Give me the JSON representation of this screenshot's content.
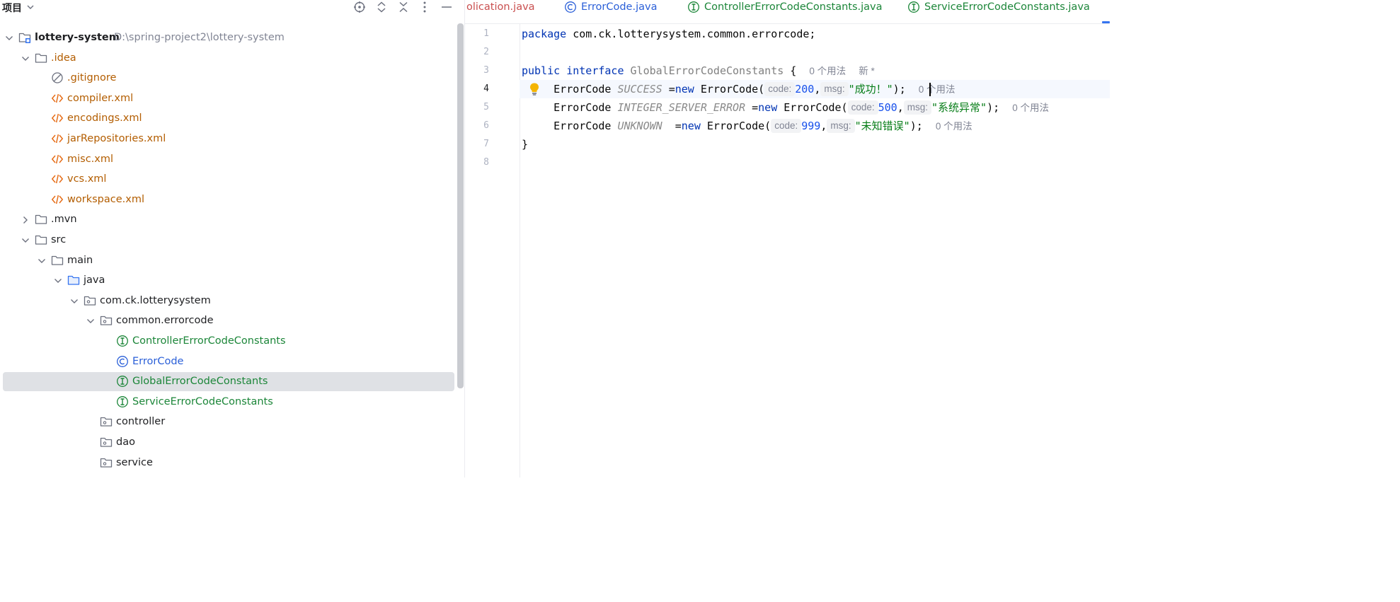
{
  "project_panel": {
    "title": "项目",
    "header_icons": [
      "locate-icon",
      "expand-all-icon",
      "collapse-all-icon",
      "more-options-icon",
      "minimize-icon"
    ],
    "tree": [
      {
        "label": "lottery-system",
        "path": "D:\\spring-project2\\lottery-system",
        "icon": "module-folder-icon",
        "depth": 0,
        "expanded": true,
        "color": "folder",
        "bold": true
      },
      {
        "label": ".idea",
        "icon": "folder-icon",
        "depth": 1,
        "expanded": true,
        "color": "idea"
      },
      {
        "label": ".gitignore",
        "icon": "ignored-file-icon",
        "depth": 2,
        "color": "idea"
      },
      {
        "label": "compiler.xml",
        "icon": "xml-file-icon",
        "depth": 2,
        "color": "xml"
      },
      {
        "label": "encodings.xml",
        "icon": "xml-file-icon",
        "depth": 2,
        "color": "xml"
      },
      {
        "label": "jarRepositories.xml",
        "icon": "xml-file-icon",
        "depth": 2,
        "color": "xml"
      },
      {
        "label": "misc.xml",
        "icon": "xml-file-icon",
        "depth": 2,
        "color": "xml"
      },
      {
        "label": "vcs.xml",
        "icon": "xml-file-icon",
        "depth": 2,
        "color": "xml"
      },
      {
        "label": "workspace.xml",
        "icon": "xml-file-icon",
        "depth": 2,
        "color": "xml"
      },
      {
        "label": ".mvn",
        "icon": "folder-icon",
        "depth": 1,
        "expanded": false,
        "color": "folder"
      },
      {
        "label": "src",
        "icon": "folder-icon",
        "depth": 1,
        "expanded": true,
        "color": "folder"
      },
      {
        "label": "main",
        "icon": "folder-icon",
        "depth": 2,
        "expanded": true,
        "color": "folder"
      },
      {
        "label": "java",
        "icon": "source-folder-icon",
        "depth": 3,
        "expanded": true,
        "color": "folder"
      },
      {
        "label": "com.ck.lotterysystem",
        "icon": "package-icon",
        "depth": 4,
        "expanded": true,
        "color": "folder"
      },
      {
        "label": "common.errorcode",
        "icon": "package-icon",
        "depth": 5,
        "expanded": true,
        "color": "folder"
      },
      {
        "label": "ControllerErrorCodeConstants",
        "icon": "interface-icon",
        "depth": 6,
        "color": "iface"
      },
      {
        "label": "ErrorCode",
        "icon": "class-icon",
        "depth": 6,
        "color": "class"
      },
      {
        "label": "GlobalErrorCodeConstants",
        "icon": "interface-icon",
        "depth": 6,
        "color": "iface",
        "selected": true
      },
      {
        "label": "ServiceErrorCodeConstants",
        "icon": "interface-icon",
        "depth": 6,
        "color": "iface"
      },
      {
        "label": "controller",
        "icon": "package-icon",
        "depth": 5,
        "color": "folder"
      },
      {
        "label": "dao",
        "icon": "package-icon",
        "depth": 5,
        "color": "folder"
      },
      {
        "label": "service",
        "icon": "package-icon",
        "depth": 5,
        "color": "folder"
      }
    ]
  },
  "tabs": [
    {
      "label": "olication.java",
      "icon": null,
      "color": "#c94f4f"
    },
    {
      "label": "ErrorCode.java",
      "icon": "class-icon",
      "color": "#2a5fd8"
    },
    {
      "label": "ControllerErrorCodeConstants.java",
      "icon": "interface-icon",
      "color": "#1c8639"
    },
    {
      "label": "ServiceErrorCodeConstants.java",
      "icon": "interface-icon",
      "color": "#1c8639"
    }
  ],
  "editor": {
    "line_numbers": [
      "1",
      "2",
      "3",
      "4",
      "5",
      "6",
      "7",
      "8"
    ],
    "current_line": 4,
    "code": {
      "l1_kw": "package",
      "l1_rest": " com.ck.lotterysystem.common.errorcode;",
      "l3_kw1": "public",
      "l3_kw2": "interface",
      "l3_name": "GlobalErrorCodeConstants",
      "l3_brace": " {",
      "l3_usage": "0 个用法",
      "l3_new": "新 *",
      "type": "ErrorCode",
      "new_kw": "new",
      "ctor": "ErrorCode(",
      "hint_code": "code:",
      "hint_msg": "msg:",
      "l4_const": "SUCCESS",
      "l4_code": "200",
      "l4_msg": "\"成功！\"",
      "l5_const": "INTEGER_SERVER_ERROR",
      "l5_code": "500",
      "l5_msg": "\"系统异常\"",
      "l6_const": "UNKNOWN",
      "l6_code": "999",
      "l6_msg": "\"未知错误\"",
      "usage": "0 个用法",
      "l7": "}"
    }
  }
}
